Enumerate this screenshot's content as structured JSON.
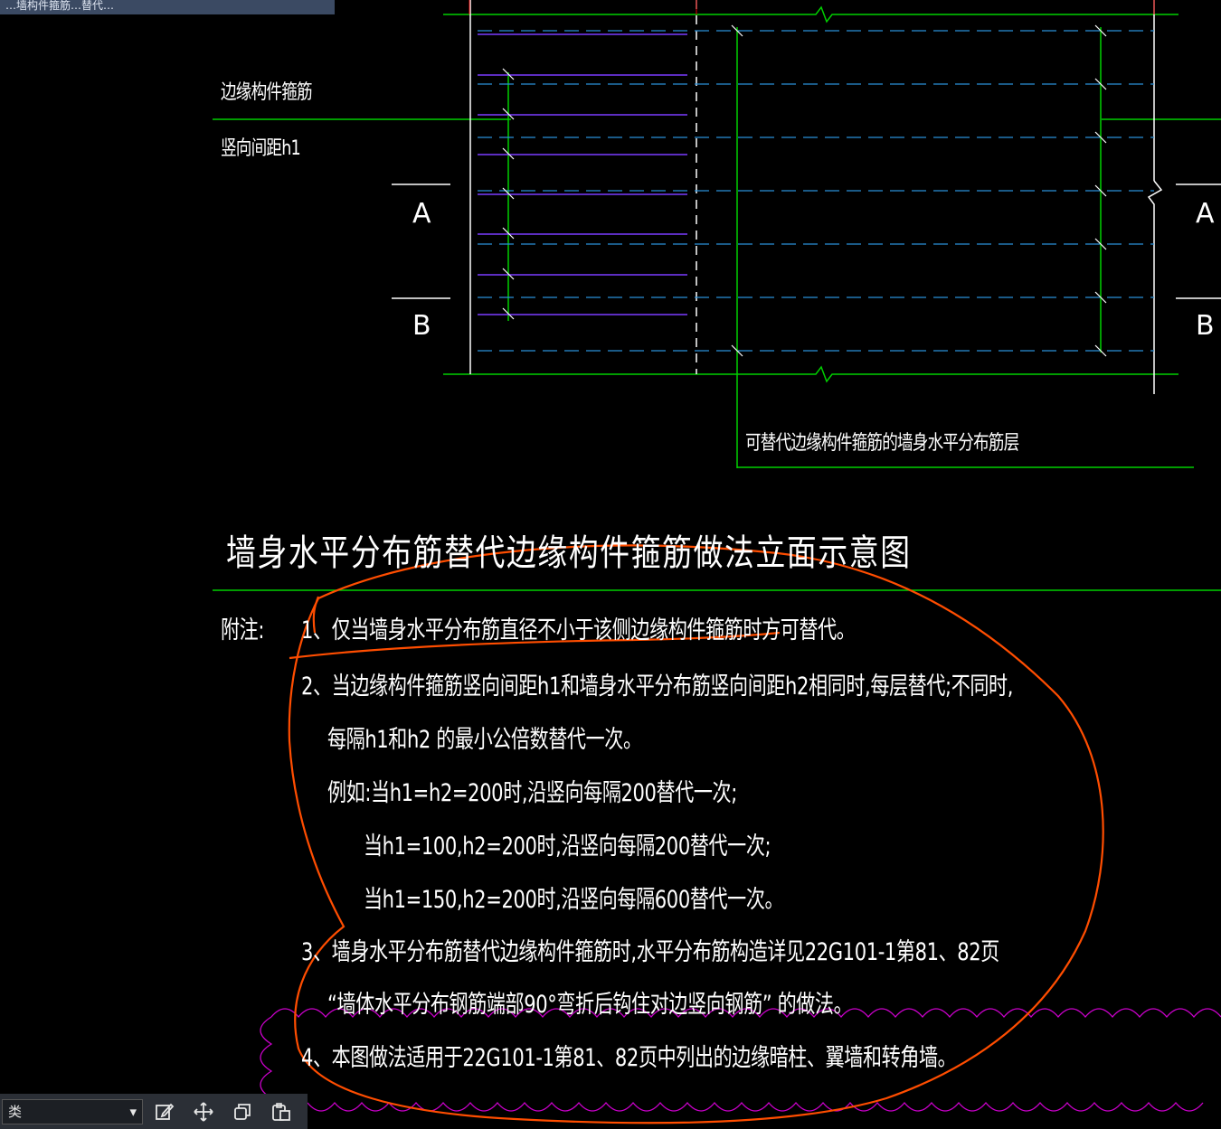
{
  "window": {
    "title_fragment": "…墙构件箍筋…替代…"
  },
  "drawing": {
    "left_labels": [
      "边缘构件箍筋",
      "竖向间距h1"
    ],
    "section_marks": [
      "A",
      "B",
      "A",
      "B"
    ],
    "callout": "可替代边缘构件箍筋的墙身水平分布筋层",
    "title": "墙身水平分布筋替代边缘构件箍筋做法立面示意图",
    "notes_label": "附注:",
    "notes": [
      "1、仅当墙身水平分布筋直径不小于该侧边缘构件箍筋时方可替代。",
      "2、当边缘构件箍筋竖向间距h1和墙身水平分布筋竖向间距h2相同时,每层替代;不同时,",
      "每隔h1和h2 的最小公倍数替代一次。",
      "例如:当h1=h2=200时,沿竖向每隔200替代一次;",
      "当h1=100,h2=200时,沿竖向每隔200替代一次;",
      "当h1=150,h2=200时,沿竖向每隔600替代一次。",
      "3、墙身水平分布筋替代边缘构件箍筋时,水平分布筋构造详见22G101-1第81、82页",
      "“墙体水平分布钢筋端部90°弯折后钩住对边竖向钢筋” 的做法。",
      "4、本图做法适用于22G101-1第81、82页中列出的边缘暗柱、翼墙和转角墙。"
    ]
  },
  "toolbar": {
    "filter_value": "类",
    "tools": [
      "edit-icon",
      "move-icon",
      "copy-icon",
      "paste-icon"
    ]
  },
  "colors": {
    "green": "#00d000",
    "blue": "#2a8fd8",
    "purple": "#7a3cff",
    "red": "#e00000",
    "magenta": "#cc00cc",
    "orange": "#ff4d00"
  }
}
